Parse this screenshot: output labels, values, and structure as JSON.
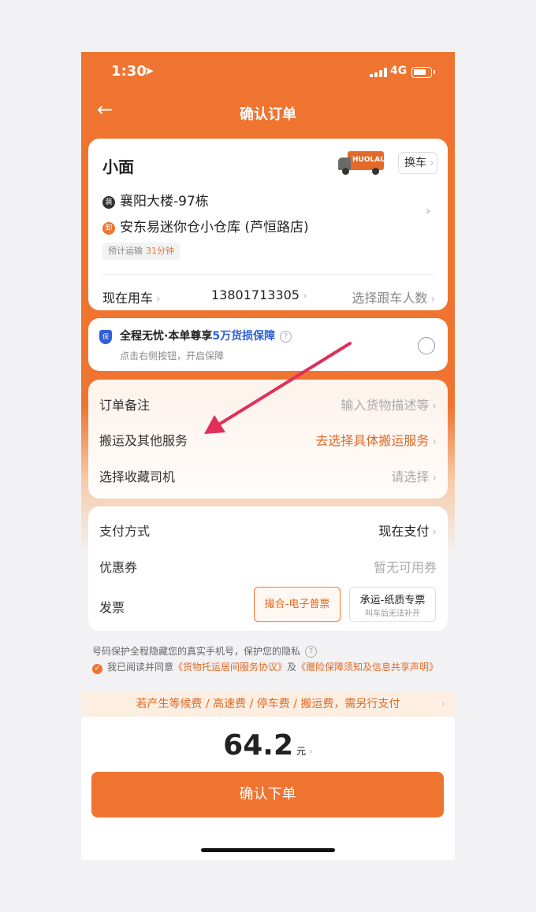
{
  "status": {
    "time": "1:30",
    "network": "4G"
  },
  "header": {
    "title": "确认订单"
  },
  "vehicle": {
    "name": "小面",
    "van_text": "HUOLALA",
    "change_label": "换车",
    "pickup_badge": "装",
    "pickup": "襄阳大楼-97栋",
    "dropoff_badge": "卸",
    "dropoff": "安东易迷你仓小仓库 (芦恒路店)",
    "eta_label": "预计运输",
    "eta_value": "31分钟",
    "time_label": "现在用车",
    "phone": "13801713305",
    "followers": "选择跟车人数"
  },
  "insurance": {
    "title_prefix": "全程无忧·本单尊享",
    "title_highlight": "5万货损保障",
    "subtitle": "点击右侧按钮，开启保障",
    "shield_text": "保"
  },
  "services": [
    {
      "label": "订单备注",
      "value": "输入货物描述等"
    },
    {
      "label": "搬运及其他服务",
      "value": "去选择具体搬运服务"
    },
    {
      "label": "选择收藏司机",
      "value": "请选择"
    }
  ],
  "payment": {
    "method_label": "支付方式",
    "method_value": "现在支付",
    "coupon_label": "优惠券",
    "coupon_value": "暂无可用券",
    "invoice_label": "发票",
    "invoice_option_a": "撮合-电子普票",
    "invoice_option_b": "承运-纸质专票",
    "invoice_option_b_note": "叫车后无法补开"
  },
  "privacy": "号码保护全程隐藏您的真实手机号，保护您的隐私",
  "agreement": {
    "prefix": "我已阅读并同意",
    "link1": "《货物托运居间服务协议》",
    "and": "及",
    "link2": "《赠险保障须知及信息共享声明》"
  },
  "fee_notice": "若产生等候费 / 高速费 / 停车费 / 搬运费，需另行支付",
  "total": {
    "amount": "64.2",
    "unit": "元"
  },
  "confirm_label": "确认下单",
  "colors": {
    "brand": "#ef7430",
    "link_blue": "#2f5fd8",
    "annotation_arrow": "#e0305a"
  }
}
